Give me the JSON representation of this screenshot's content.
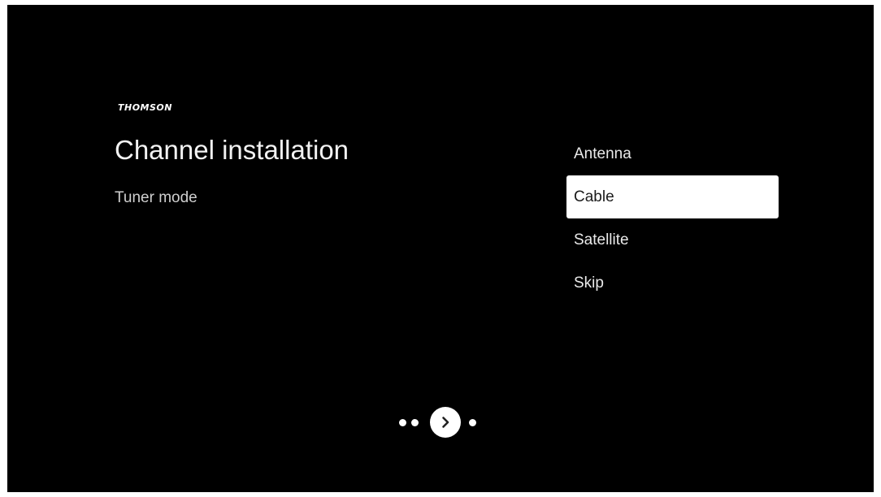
{
  "brand": {
    "logo_text": "THOMSON"
  },
  "header": {
    "title": "Channel installation",
    "subtitle": "Tuner mode"
  },
  "options": {
    "items": [
      {
        "label": "Antenna",
        "selected": false
      },
      {
        "label": "Cable",
        "selected": true
      },
      {
        "label": "Satellite",
        "selected": false
      },
      {
        "label": "Skip",
        "selected": false
      }
    ]
  },
  "pager": {
    "next_icon": "chevron-right-icon",
    "current_step": 3,
    "total_steps": 4
  },
  "colors": {
    "background": "#000000",
    "text": "#ffffff",
    "selected_background": "#ffffff",
    "selected_text": "#1a1a1a"
  }
}
